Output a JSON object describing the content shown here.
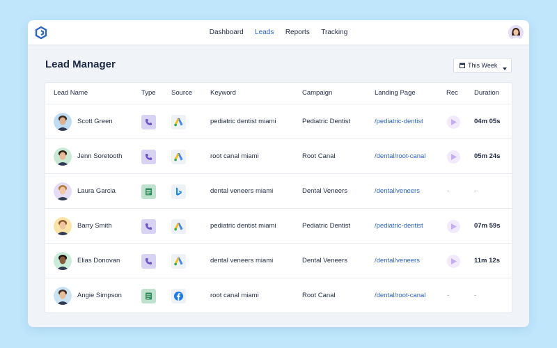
{
  "nav": {
    "items": [
      {
        "label": "Dashboard",
        "active": false
      },
      {
        "label": "Leads",
        "active": true
      },
      {
        "label": "Reports",
        "active": false
      },
      {
        "label": "Tracking",
        "active": false
      }
    ]
  },
  "page": {
    "title": "Lead Manager",
    "range_label": "This Week"
  },
  "table": {
    "columns": [
      "Lead Name",
      "Type",
      "Source",
      "Keyword",
      "Campaign",
      "Landing Page",
      "Rec",
      "Duration"
    ],
    "rows": [
      {
        "name": "Scott Green",
        "type": "call",
        "source": "google-ads",
        "keyword": "pediatric dentist miami",
        "campaign": "Pediatric Dentist",
        "landing": "/pediatric-dentist",
        "rec": true,
        "duration": "04m 05s",
        "avatar_bg": "#bfdcf5",
        "skin": "#e0b08c",
        "hair": "#3a2a22"
      },
      {
        "name": "Jenn Soretooth",
        "type": "call",
        "source": "google-ads",
        "keyword": "root canal miami",
        "campaign": "Root Canal",
        "landing": "/dental/root-canal",
        "rec": true,
        "duration": "05m 24s",
        "avatar_bg": "#c8ead4",
        "skin": "#e8b992",
        "hair": "#2a1c16"
      },
      {
        "name": "Laura Garcia",
        "type": "form",
        "source": "bing",
        "keyword": "dental veneers miami",
        "campaign": "Dental Veneers",
        "landing": "/dental/veneers",
        "rec": false,
        "rec_text": "-",
        "duration": "-",
        "avatar_bg": "#e4dcf5",
        "skin": "#f1c7a5",
        "hair": "#b07a3a"
      },
      {
        "name": "Barry Smith",
        "type": "call",
        "source": "google-ads",
        "keyword": "pediatric dentist miami",
        "campaign": "Pediatric Dentist",
        "landing": "/pediatric-dentist",
        "rec": true,
        "duration": "07m 59s",
        "avatar_bg": "#fbe3a7",
        "skin": "#f0c6a0",
        "hair": "#8a5a2e"
      },
      {
        "name": "Elias Donovan",
        "type": "call",
        "source": "google-ads",
        "keyword": "dental veneers miami",
        "campaign": "Dental Veneers",
        "landing": "/dental/veneers",
        "rec": true,
        "duration": "11m 12s",
        "avatar_bg": "#c9ecd9",
        "skin": "#8a5a3c",
        "hair": "#1c1410"
      },
      {
        "name": "Angie Simpson",
        "type": "form",
        "source": "facebook",
        "keyword": "root canal miami",
        "campaign": "Root Canal",
        "landing": "/dental/root-canal",
        "rec": false,
        "rec_text": "-",
        "duration": "-",
        "avatar_bg": "#c9e3f2",
        "skin": "#e9bc98",
        "hair": "#3b2a22"
      }
    ]
  },
  "colors": {
    "accent": "#2c64c8",
    "background": "#bfe6fb",
    "call_badge": "#d8d2f4",
    "form_badge": "#bfe2cf",
    "play_bg": "#f1eafc"
  }
}
